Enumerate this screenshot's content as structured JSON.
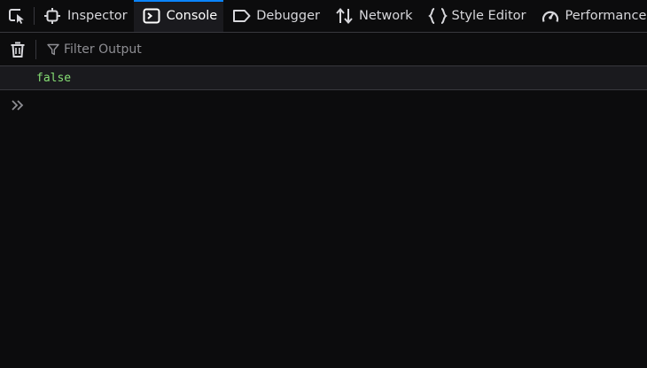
{
  "toolbar": {
    "tabs": [
      {
        "label": "Inspector",
        "icon": "inspector-icon"
      },
      {
        "label": "Console",
        "icon": "console-icon",
        "active": true
      },
      {
        "label": "Debugger",
        "icon": "debugger-icon"
      },
      {
        "label": "Network",
        "icon": "network-icon"
      },
      {
        "label": "Style Editor",
        "icon": "style-editor-icon"
      },
      {
        "label": "Performance",
        "icon": "performance-icon"
      }
    ]
  },
  "filterbar": {
    "clear_icon": "trash-icon",
    "filter_icon": "filter-icon",
    "placeholder": "Filter Output",
    "value": ""
  },
  "console": {
    "messages": [
      {
        "text": "false",
        "type": "boolean-result"
      }
    ],
    "prompt_icon": "chevron-double-right-icon"
  },
  "colors": {
    "background": "#0c0c0d",
    "active_tab": "#1a1a1e",
    "accent": "#0a84ff",
    "boolean_value": "#86de74",
    "border": "#38383d"
  }
}
